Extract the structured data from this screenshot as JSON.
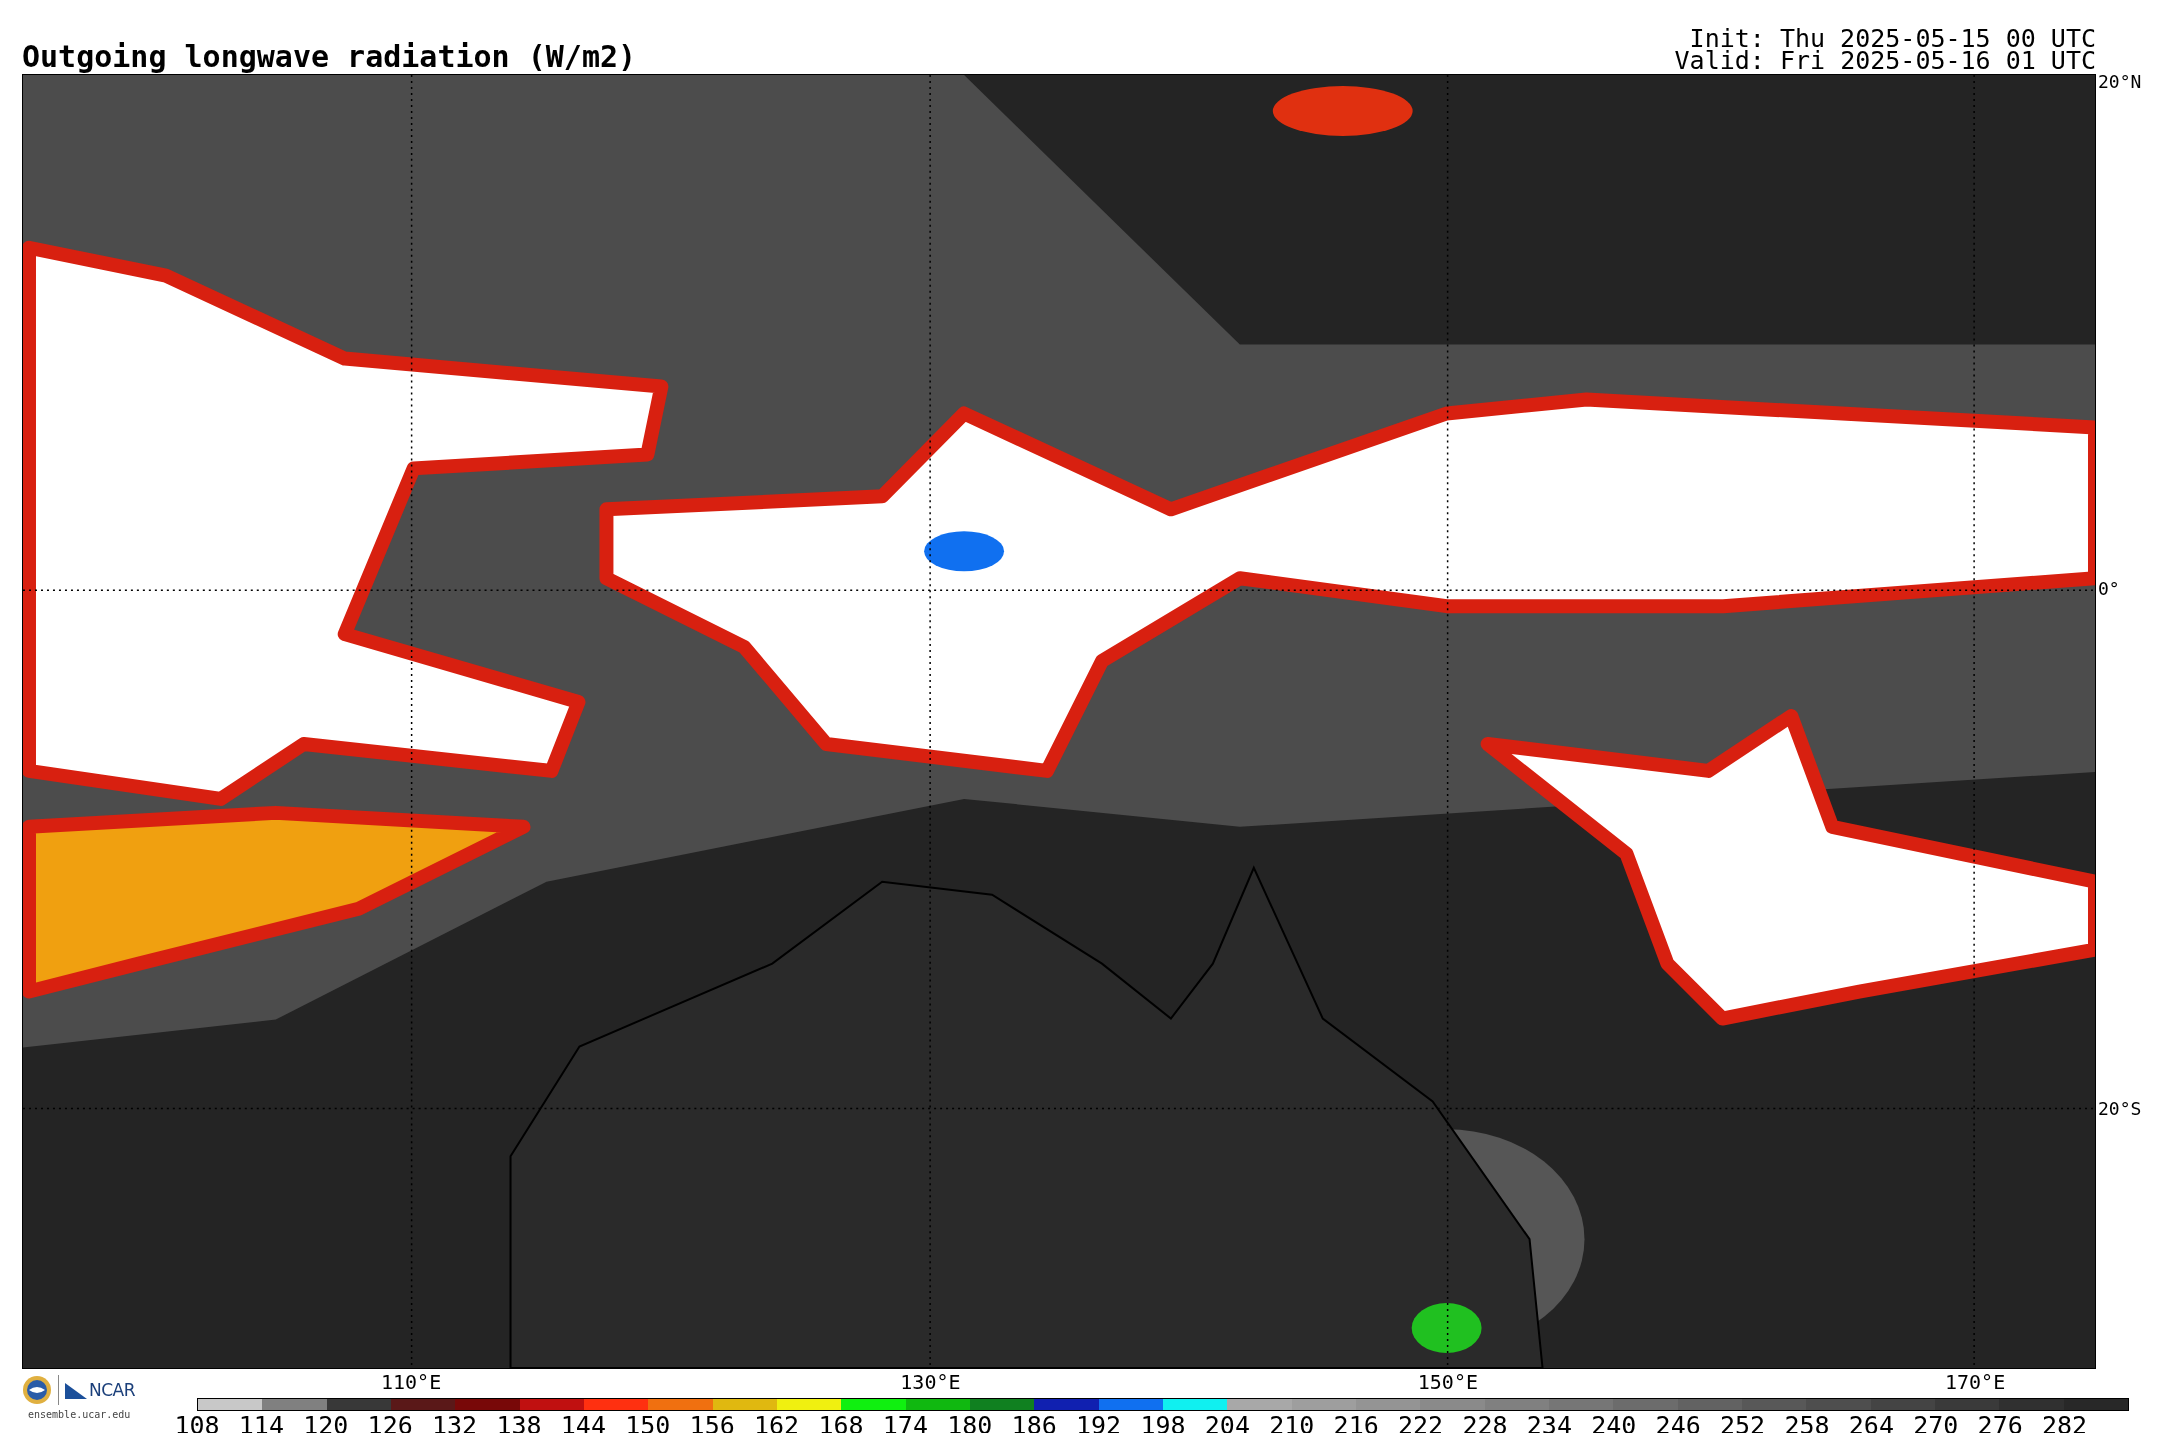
{
  "title": "Outgoing longwave radiation (W/m2)",
  "run_info": [
    "Init: Thu 2025-05-15 00 UTC",
    "Valid: Fri 2025-05-16 01 UTC"
  ],
  "map": {
    "latitude_labels": [
      "20°N",
      "0°",
      "20°S"
    ],
    "longitude_labels": [
      "110°E",
      "130°E",
      "150°E",
      "170°E"
    ]
  },
  "logos": {
    "agency": "NCAR",
    "site": "ensemble.ucar.edu"
  },
  "colorbar": [
    {
      "label": "108",
      "color": "#c8c8c8"
    },
    {
      "label": "114",
      "color": "#808080"
    },
    {
      "label": "120",
      "color": "#383838"
    },
    {
      "label": "126",
      "color": "#5a1818"
    },
    {
      "label": "132",
      "color": "#780808"
    },
    {
      "label": "138",
      "color": "#c01010"
    },
    {
      "label": "144",
      "color": "#ff3010"
    },
    {
      "label": "150",
      "color": "#f07010"
    },
    {
      "label": "156",
      "color": "#e0b810"
    },
    {
      "label": "162",
      "color": "#f0f010"
    },
    {
      "label": "168",
      "color": "#10f010"
    },
    {
      "label": "174",
      "color": "#10b810"
    },
    {
      "label": "180",
      "color": "#108020"
    },
    {
      "label": "186",
      "color": "#1020b0"
    },
    {
      "label": "192",
      "color": "#1070f0"
    },
    {
      "label": "198",
      "color": "#10f0f0"
    },
    {
      "label": "204",
      "color": "#a8a8a8"
    },
    {
      "label": "210",
      "color": "#9e9e9e"
    },
    {
      "label": "216",
      "color": "#949494"
    },
    {
      "label": "222",
      "color": "#8a8a8a"
    },
    {
      "label": "228",
      "color": "#808080"
    },
    {
      "label": "234",
      "color": "#767676"
    },
    {
      "label": "240",
      "color": "#6c6c6c"
    },
    {
      "label": "246",
      "color": "#626262"
    },
    {
      "label": "252",
      "color": "#585858"
    },
    {
      "label": "258",
      "color": "#4e4e4e"
    },
    {
      "label": "264",
      "color": "#444444"
    },
    {
      "label": "270",
      "color": "#3a3a3a"
    },
    {
      "label": "276",
      "color": "#303030"
    },
    {
      "label": "282",
      "color": "#282828"
    }
  ]
}
